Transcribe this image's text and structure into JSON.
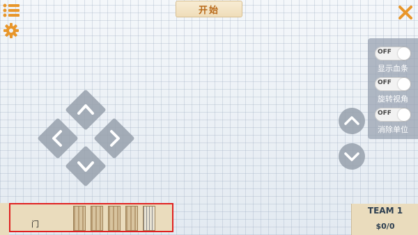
{
  "topbar": {
    "menu_icon": "list-icon",
    "settings_icon": "gear-icon",
    "start_label": "开始",
    "close_icon": "close-icon"
  },
  "toggles": [
    {
      "state": "OFF",
      "label": "显示血条"
    },
    {
      "state": "OFF",
      "label": "旋转视角"
    },
    {
      "state": "OFF",
      "label": "消除单位"
    }
  ],
  "dpad": {
    "up_icon": "arrow-up-icon",
    "down_icon": "arrow-down-icon",
    "left_icon": "arrow-left-icon",
    "right_icon": "arrow-right-icon"
  },
  "camera": {
    "raise_icon": "chevron-up-icon",
    "lower_icon": "chevron-down-icon"
  },
  "bottom_bar": {
    "selected_item": "门"
  },
  "team": {
    "name": "TEAM 1",
    "money": "$0/0"
  },
  "colors": {
    "accent_orange": "#e8962a",
    "start_text": "#b96a1a",
    "panel_bg": "#eadcbd",
    "highlight_border": "#e02020"
  }
}
